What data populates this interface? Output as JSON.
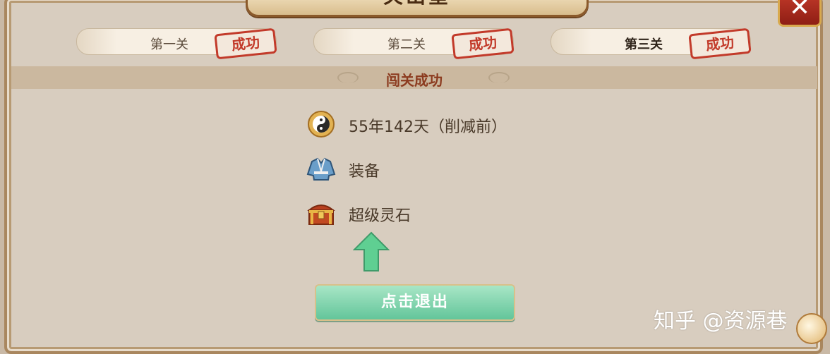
{
  "window": {
    "title": "关山堂",
    "close_label": "✕"
  },
  "stages": [
    {
      "label": "第一关",
      "status": "成功"
    },
    {
      "label": "第二关",
      "status": "成功"
    },
    {
      "label": "第三关",
      "status": "成功"
    }
  ],
  "result": {
    "heading": "闯关成功"
  },
  "rewards": [
    {
      "icon": "yin-yang-coin-icon",
      "text": "55年142天（削减前）"
    },
    {
      "icon": "robe-equipment-icon",
      "text": "装备"
    },
    {
      "icon": "treasure-chest-icon",
      "text": "超级灵石"
    }
  ],
  "exit_button": {
    "label": "点击退出"
  },
  "watermark": {
    "text": "知乎 @资源巷"
  },
  "colors": {
    "panel": "#d8cdbf",
    "stamp_red": "#c23a2a",
    "exit_green": "#63c59a",
    "arrow_green": "#5fcf92"
  }
}
